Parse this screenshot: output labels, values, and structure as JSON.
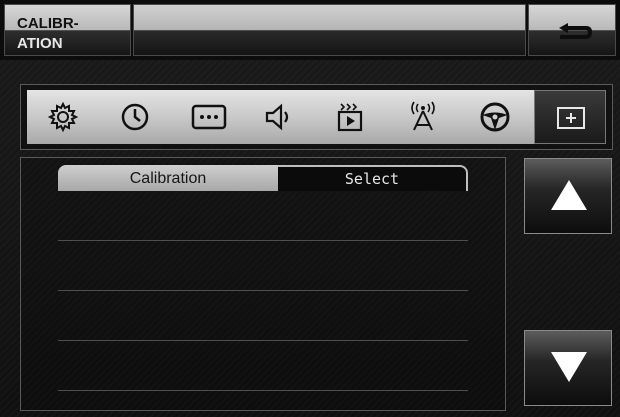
{
  "header": {
    "title_line1": "CALIBR-",
    "title_line2": "ATION",
    "back_icon": "back-arrow-icon"
  },
  "toolbar": {
    "icons": [
      "gear-icon",
      "clock-icon",
      "more-icon",
      "speaker-icon",
      "media-icon",
      "antenna-icon",
      "steering-wheel-icon",
      "plus-box-icon"
    ],
    "active": "plus-box-icon"
  },
  "list": {
    "header_left": "Calibration",
    "header_right": "Select",
    "rows": [
      "",
      "",
      "",
      ""
    ]
  },
  "scroll": {
    "up_icon": "up-arrow-icon",
    "down_icon": "down-arrow-icon"
  }
}
